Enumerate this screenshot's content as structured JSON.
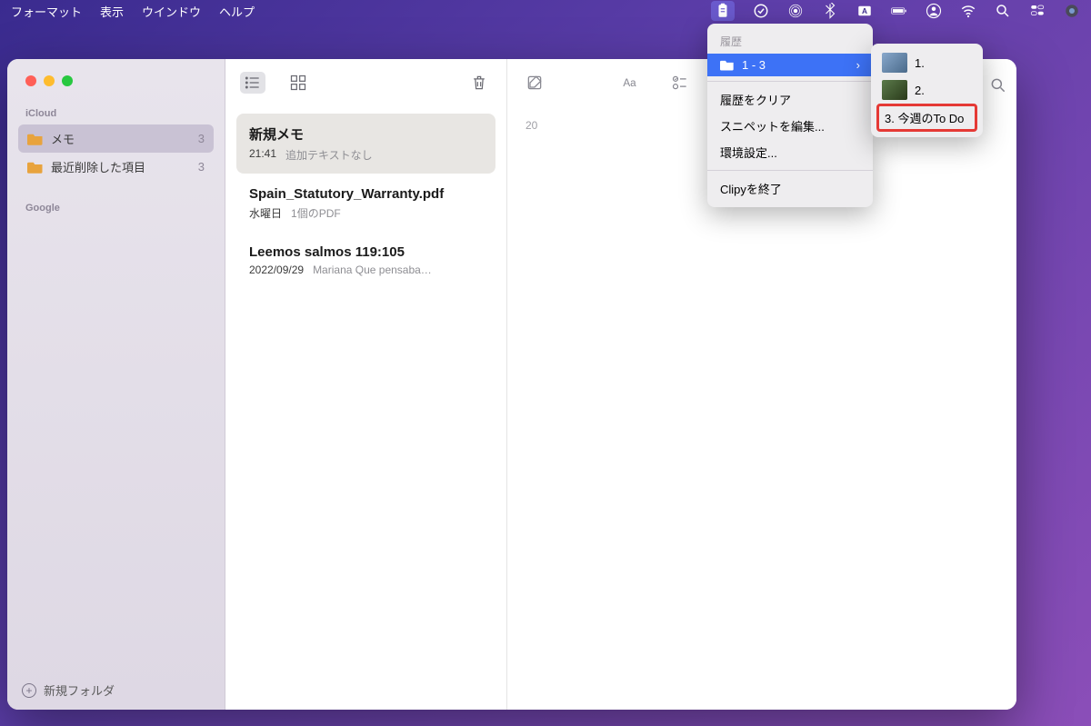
{
  "menubar": {
    "items": [
      "フォーマット",
      "表示",
      "ウインドウ",
      "ヘルプ"
    ]
  },
  "sidebar": {
    "sections": [
      {
        "header": "iCloud",
        "items": [
          {
            "label": "メモ",
            "count": "3",
            "selected": true
          },
          {
            "label": "最近削除した項目",
            "count": "3",
            "selected": false
          }
        ]
      },
      {
        "header": "Google",
        "items": []
      }
    ],
    "footer": "新規フォルダ"
  },
  "notes": [
    {
      "title": "新規メモ",
      "time": "21:41",
      "preview": "追加テキストなし",
      "selected": true
    },
    {
      "title": "Spain_Statutory_Warranty.pdf",
      "time": "水曜日",
      "preview": "1個のPDF",
      "selected": false
    },
    {
      "title": "Leemos salmos 119:105",
      "time": "2022/09/29",
      "preview": "Mariana Que pensaba…",
      "selected": false
    }
  ],
  "detail": {
    "date_partial": "20"
  },
  "clipy": {
    "header": "履歴",
    "highlighted": "1 - 3",
    "items": [
      "履歴をクリア",
      "スニペットを編集...",
      "環境設定..."
    ],
    "quit": "Clipyを終了"
  },
  "submenu": {
    "items": [
      {
        "label": "1.",
        "thumb": true
      },
      {
        "label": "2.",
        "thumb": true
      },
      {
        "label": "3. 今週のTo Do",
        "thumb": false,
        "highlighted": true
      }
    ]
  }
}
